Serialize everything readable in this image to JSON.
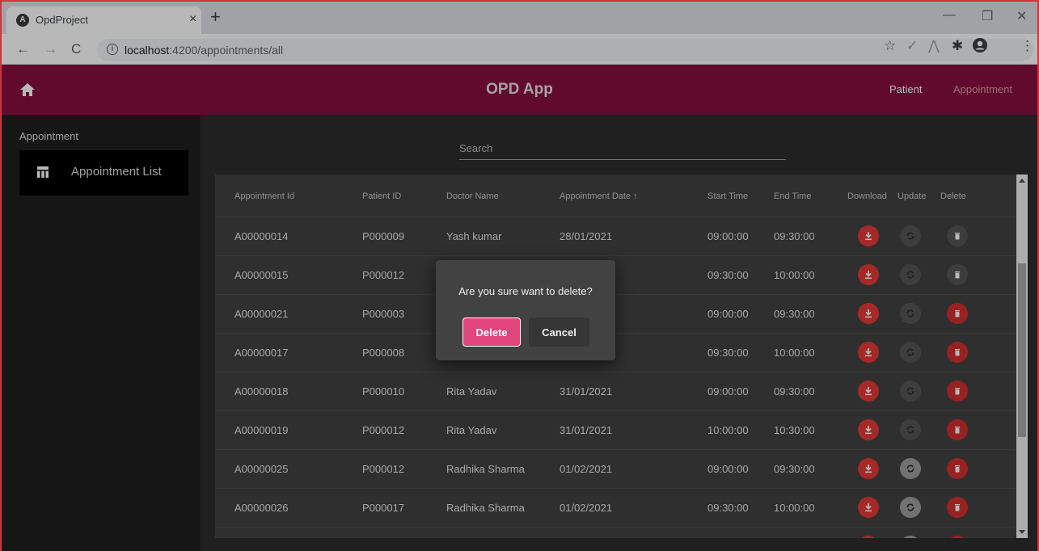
{
  "browser": {
    "tab_title": "OpdProject",
    "tab_close": "×",
    "new_tab": "+",
    "url_host": "localhost",
    "url_rest": ":4200/appointments/all",
    "back": "←",
    "forward": "→",
    "reload": "C",
    "minimize": "—",
    "restore": "❐",
    "close": "✕",
    "star": "☆",
    "check": "✓",
    "ext1": "⋀",
    "puzzle": "✱",
    "menu": "⋮"
  },
  "header": {
    "title": "OPD App",
    "nav": [
      {
        "label": "Patient",
        "color": "#ffffff"
      },
      {
        "label": "Appointment",
        "color": "#d89aa8"
      }
    ]
  },
  "sidebar": {
    "heading": "Appointment",
    "items": [
      {
        "label": "Appointment List",
        "icon": "table-icon"
      }
    ]
  },
  "search": {
    "label": "Search"
  },
  "table": {
    "headers": [
      "Appointment Id",
      "Patient ID",
      "Doctor Name",
      "Appointment Date ↑",
      "Start Time",
      "End Time",
      "Download",
      "Update",
      "Delete"
    ],
    "rows": [
      {
        "id": "A00000014",
        "patient": "P000009",
        "doctor": "Yash kumar",
        "date": "28/01/2021",
        "start": "09:00:00",
        "end": "09:30:00",
        "update_enabled": false,
        "delete_enabled": false
      },
      {
        "id": "A00000015",
        "patient": "P000012",
        "doctor": "",
        "date": ")21",
        "start": "09:30:00",
        "end": "10:00:00",
        "update_enabled": false,
        "delete_enabled": false
      },
      {
        "id": "A00000021",
        "patient": "P000003",
        "doctor": "",
        "date": ")21",
        "start": "09:00:00",
        "end": "09:30:00",
        "update_enabled": false,
        "delete_enabled": true
      },
      {
        "id": "A00000017",
        "patient": "P000008",
        "doctor": "",
        "date": ")21",
        "start": "09:30:00",
        "end": "10:00:00",
        "update_enabled": false,
        "delete_enabled": true
      },
      {
        "id": "A00000018",
        "patient": "P000010",
        "doctor": "Rita Yadav",
        "date": "31/01/2021",
        "start": "09:00:00",
        "end": "09:30:00",
        "update_enabled": false,
        "delete_enabled": true
      },
      {
        "id": "A00000019",
        "patient": "P000012",
        "doctor": "Rita Yadav",
        "date": "31/01/2021",
        "start": "10:00:00",
        "end": "10:30:00",
        "update_enabled": false,
        "delete_enabled": true
      },
      {
        "id": "A00000025",
        "patient": "P000012",
        "doctor": "Radhika Sharma",
        "date": "01/02/2021",
        "start": "09:00:00",
        "end": "09:30:00",
        "update_enabled": true,
        "delete_enabled": true
      },
      {
        "id": "A00000026",
        "patient": "P000017",
        "doctor": "Radhika Sharma",
        "date": "01/02/2021",
        "start": "09:30:00",
        "end": "10:00:00",
        "update_enabled": true,
        "delete_enabled": true
      }
    ]
  },
  "dialog": {
    "message": "Are you sure want to delete?",
    "confirm_label": "Delete",
    "cancel_label": "Cancel"
  },
  "colors": {
    "appbar": "#880e3f",
    "download": "#e53935",
    "delete": "#d32f2f",
    "dialog_confirm": "#e0457b"
  }
}
